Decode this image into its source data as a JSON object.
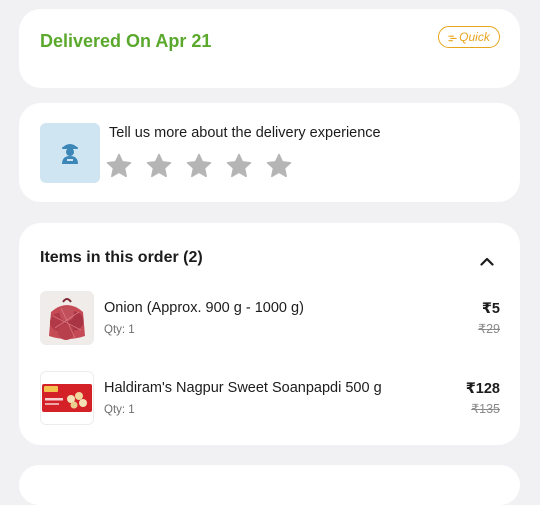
{
  "delivery": {
    "status_text": "Delivered On Apr 21",
    "quick_badge": "Quick",
    "colors": {
      "status": "#5aa92d",
      "badge": "#e7a51c"
    }
  },
  "rating": {
    "prompt": "Tell us more about the delivery experience",
    "stars_total": 5,
    "stars_filled": 0,
    "avatar_icon": "delivery-person-icon",
    "star_icon": "star-icon"
  },
  "order": {
    "title": "Items in this order (2)",
    "toggle_icon": "chevron-up-icon",
    "items": [
      {
        "name": "Onion (Approx. 900 g - 1000 g)",
        "qty": "Qty: 1",
        "price": "₹5",
        "mrp": "₹29",
        "thumb_icon": "onion-product-image"
      },
      {
        "name": "Haldiram's Nagpur Sweet Soanpapdi 500 g",
        "qty": "Qty: 1",
        "price": "₹128",
        "mrp": "₹135",
        "thumb_icon": "soanpapdi-product-image"
      }
    ]
  }
}
